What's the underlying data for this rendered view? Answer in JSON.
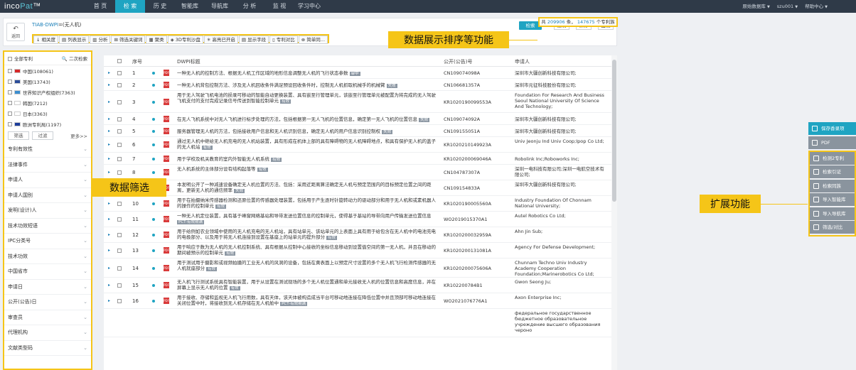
{
  "app": {
    "logo_a": "inco",
    "logo_b": "Pat",
    "logo_c": "™"
  },
  "nav": [
    "首 页",
    "检 索",
    "历 史",
    "智能库",
    "导航库",
    "分 析",
    "监 视",
    "学习中心"
  ],
  "nav_right": {
    "db": "原始数据库",
    "user": "szu001",
    "help": "帮助中心"
  },
  "query": {
    "field": "TIAB-DWPI",
    "rest": "=(无人机)",
    "back": "返回"
  },
  "actions": {
    "search": "检索",
    "copy": "复制",
    "save": "保存",
    "monitor": "监视"
  },
  "toolbar": [
    "↓ 相关度",
    "▤ 列表显示",
    "▥ 分析",
    "⊞ 筛选关键词",
    "▦ 聚类",
    "◈ 3D专利沙盘",
    "✳ 高亮已开启",
    "▤ 显示字段",
    "▯ 专利对比",
    "⊗ 简单同..."
  ],
  "count": {
    "pre": "共",
    "total": "209906",
    "mid": "条，",
    "families": "147675",
    "post": "个专利族"
  },
  "sidebar": {
    "all": "全部专利",
    "secondary": "二次检索",
    "countries": [
      {
        "name": "中国(108061)",
        "color": "#d62828"
      },
      {
        "name": "美国(13743)",
        "color": "#2b4c9a"
      },
      {
        "name": "世界知识产权组织(7363)",
        "color": "#3b8ed0"
      },
      {
        "name": "韩国(7212)",
        "color": "#ffffff"
      },
      {
        "name": "日本(3363)",
        "color": "#ffffff"
      },
      {
        "name": "欧洲专利局(1197)",
        "color": "#1d3d9a"
      }
    ],
    "filter": "筛选",
    "filter2": "过滤",
    "more": "更多>>",
    "facets": [
      "专利有效性",
      "法律事件",
      "申请人",
      "申请人国别",
      "发明(设计)人",
      "技术功效短语",
      "IPC分类号",
      "技术功效",
      "中国省市",
      "申请日",
      "公开(公告)日",
      "审查员",
      "代理机构",
      "文献类型码"
    ]
  },
  "table": {
    "headers": {
      "no": "序号",
      "title": "DWPI标题",
      "pub": "公开(公告)号",
      "app": "申请人"
    },
    "rows": [
      {
        "no": "1",
        "title": "一种无人机的控制方法、根据无人机工作区域的地形信息调整无人机的飞行状态参数",
        "badge": "审中",
        "pub": "CN109074098A",
        "app": "深圳市大疆创新科技有限公司;"
      },
      {
        "no": "2",
        "title": "一种无人机背包控制方法、涉及无人机回收条件满足预设回收条件时，控制无人机抓取机械手的机械臂",
        "badge": "失效",
        "pub": "CN106681357A",
        "app": "深圳市元征科技股份有限公司;"
      },
      {
        "no": "3",
        "title": "用于无人驾驶飞机电池的损录可移动的智能自动更换装置、具有嵌至行管理单元，该嵌至行管理单元被配置为将完成的无人驾驶飞机支付的支付完成记录信号传送到智能控制单元",
        "badge": "有效",
        "pub": "KR1020190099553A",
        "app": "Foundation For Research And Business Seoul National University Of Science And Technology;"
      },
      {
        "no": "4",
        "title": "在无人飞机系统中对无人飞机进行标步处理的方法，包括根据第一无人飞机的位置信息，确定第一无人飞机的位置信息",
        "badge": "失效",
        "pub": "CN109074092A",
        "app": "深圳市大疆创新科技有限公司;"
      },
      {
        "no": "5",
        "title": "服务器管理无人机的方法，包括接收用户信息和无人机识别信息，确定无人机的用户信息识别控制权",
        "badge": "失效",
        "pub": "CN109155051A",
        "app": "深圳市大疆创新科技有限公司;"
      },
      {
        "no": "6",
        "title": "通过无人机中继给无人机充电的无人机站装置，具有形成在机体上部的具有障碍物的无人机障碍地点，和具有保护无人机的盖子的无人机站",
        "badge": "有效",
        "pub": "KR1020210149923A",
        "app": "Univ Jeonju Ind Univ Coop;Ipop Co Ltd;"
      },
      {
        "no": "7",
        "title": "用于学校及机关教育的室内外智能无人机系统",
        "badge": "有效",
        "pub": "KR1020200069046A",
        "app": "Robolink Inc;Roboworks Inc;"
      },
      {
        "no": "8",
        "title": "无人机系统的主体部分设有结构起落等",
        "badge": "有效",
        "pub": "CN104787307A",
        "app": "深圳一电科技有限公司;深圳一电航空技术有限公司;"
      },
      {
        "no": "9",
        "title": "本发明公开了一种减速设备确定无人机位置的方法、包括：采用近距离算法确定无人机与预定范围内的目标预定位置之间的距离，更新无人机的通信频率",
        "badge": "失效",
        "pub": "CN109154833A",
        "app": "深圳市大疆创新科技有限公司;"
      },
      {
        "no": "10",
        "title": "用于在拍摄纳米传感器检测和还原位置的传感器处理装置，包括用于产生逐时针旋转动力的驱动部分和用于无人机和或素机器人的操作的控制单元",
        "badge": "有效",
        "pub": "KR1020190005560A",
        "app": "Industry Foundation Of Chonnam National University;"
      },
      {
        "no": "11",
        "title": "一种无人机定位装置，具有基于峰窗网络基站和导带发送位置信息的控制单元，使得基于基站的导带向用户传输发送位置信息",
        "badge": "PCT-有效期满",
        "pub": "WO2019015370A1",
        "app": "Autel Robotics Co Ltd;"
      },
      {
        "no": "12",
        "title": "用于给例如农业领域中使用的无人机充电的无人机站，具有站单元、该站单元的上表面上具有用于给包含在无人机中的电池充电的电极部分、以及用于将无人机连接到设置在基座上的站单元的提升部分",
        "badge": "有效",
        "pub": "KR1020200032959A",
        "app": "Ahn Jin Sub;"
      },
      {
        "no": "13",
        "title": "用于响应于数为无人机的无人机控制系统、具有根据从控制中心接收的坐标信息移动到设置值空间的第一无人机，并且在移动的期间被预示的控制单元",
        "badge": "有效",
        "pub": "KR1020200131081A",
        "app": "Agency For Defense Development;"
      },
      {
        "no": "14",
        "title": "用于测试用于摄影和或视频拍摄的工业无人机的风洞的设备，包括在黄表面上以预定尺寸设置的多个无人机飞行检测传感器的无人机就座部分",
        "badge": "有效",
        "pub": "KR1020200075606A",
        "app": "Chunnam Techno Univ Industry Academy Cooperation Foundation;Marinerobotics Co Ltd;"
      },
      {
        "no": "15",
        "title": "无人机飞行测试系统具有智能装置，用于从设置在测试现场的多个无人机位置通和单元接收无人机的位置信息和高度信息，并在屏幕上显示无人机的位置",
        "badge": "有效",
        "pub": "KR102200784B1",
        "app": "Gwon Seong Ju;"
      },
      {
        "no": "16",
        "title": "用于接收、存储和监视无人机飞行用数，具有天体，该天体被构造成当平台可移动地连接在降低位置中并且顶部可移动地连接在关闭位置中时，将接收到无人机存储在无人机舱中",
        "badge": "PCT-有效期满",
        "pub": "WO2021076776A1",
        "app": "Axon Enterprise Inc;"
      },
      {
        "no": "",
        "title": "",
        "badge": "",
        "pub": "",
        "app": "федеральное государственное бюджетное образовательное учреждение высшего образования чероно"
      }
    ]
  },
  "rpanel": {
    "save": "保存香录项",
    "pdf": "PDF",
    "items": [
      "检测2专利",
      "检索引证",
      "检索同族",
      "导入智能库",
      "导入导航库",
      "筛选/对比"
    ]
  },
  "callouts": {
    "display": "数据展示排序等功能",
    "filter": "数据筛选",
    "extend": "扩展功能"
  },
  "colors": {
    "accent": "#1fa4c2",
    "highlight": "#f5c518",
    "nav_bg": "#2f3a48"
  }
}
